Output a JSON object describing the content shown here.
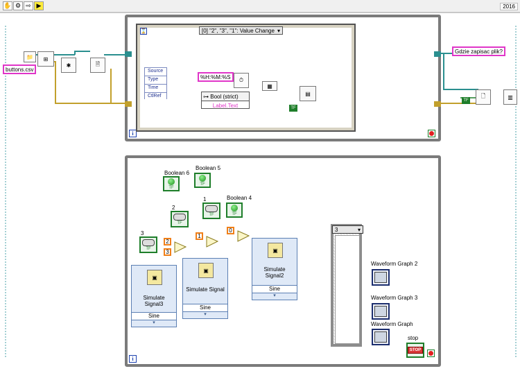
{
  "toolbar": {
    "icons": [
      "hand-icon",
      "chain-icon",
      "step-into-icon",
      "run-arrow-icon"
    ],
    "version": "2016"
  },
  "top_loop": {
    "event_case_label": "[0] \"2\", \"3\", \"1\": Value Change",
    "event_data": [
      "Source",
      "Type",
      "Time",
      "CtlRef"
    ],
    "time_format": "%H:%M:%S",
    "bool_unbundle": "Bool (strict)",
    "label_text": "Label.Text",
    "filename": "buttons.csv",
    "dialog_prompt": "Gdzie zapisac plik?",
    "true_constant": "TF"
  },
  "bottom_loop": {
    "booleans": [
      {
        "label": "Boolean 6"
      },
      {
        "label": "Boolean 5"
      },
      {
        "label": "Boolean 4"
      }
    ],
    "buttons": [
      {
        "label": "3"
      },
      {
        "label": "2"
      },
      {
        "label": "1"
      }
    ],
    "constants": [
      "2",
      "1",
      "0",
      "3"
    ],
    "simulators": [
      {
        "title": "Simulate Signal3",
        "line1": "Simulate",
        "line2": "Signal3",
        "mode": "Sine"
      },
      {
        "title": "Simulate Signal",
        "line1": "Simulate Signal",
        "line2": "",
        "mode": "Sine"
      },
      {
        "title": "Simulate Signal2",
        "line1": "Simulate",
        "line2": "Signal2",
        "mode": "Sine"
      }
    ],
    "case_selector": "3",
    "graphs": [
      {
        "label": "Waveform Graph 2"
      },
      {
        "label": "Waveform Graph 3"
      },
      {
        "label": "Waveform Graph"
      }
    ],
    "stop_label": "stop",
    "stop_button_text": "STOP"
  }
}
